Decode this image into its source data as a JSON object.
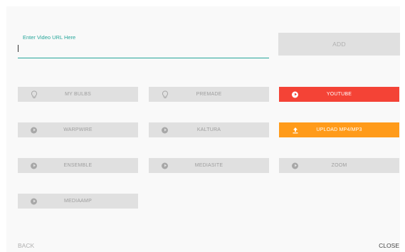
{
  "url_field": {
    "label": "Enter Video URL Here",
    "value": ""
  },
  "add_button": "ADD",
  "sources": {
    "my_bulbs": "MY BULBS",
    "premade": "PREMADE",
    "youtube": "YOUTUBE",
    "warpwire": "WARPWIRE",
    "kaltura": "KALTURA",
    "upload": "UPLOAD MP4/MP3",
    "ensemble": "ENSEMBLE",
    "mediasite": "MEDIASITE",
    "zoom": "ZOOM",
    "mediaamp": "MEDIAAMP"
  },
  "icons": {
    "my_bulbs": "bulb-icon",
    "premade": "bulb-icon",
    "youtube": "play-circle-icon",
    "warpwire": "play-circle-icon",
    "kaltura": "play-circle-icon",
    "upload": "upload-icon",
    "ensemble": "play-circle-icon",
    "mediasite": "play-circle-icon",
    "zoom": "play-circle-icon",
    "mediaamp": "play-circle-icon"
  },
  "colors": {
    "accent": "#26a69a",
    "youtube": "#f44336",
    "upload": "#ff9b1a",
    "disabled": "#e0e0e0"
  },
  "footer": {
    "back": "BACK",
    "close": "CLOSE"
  }
}
